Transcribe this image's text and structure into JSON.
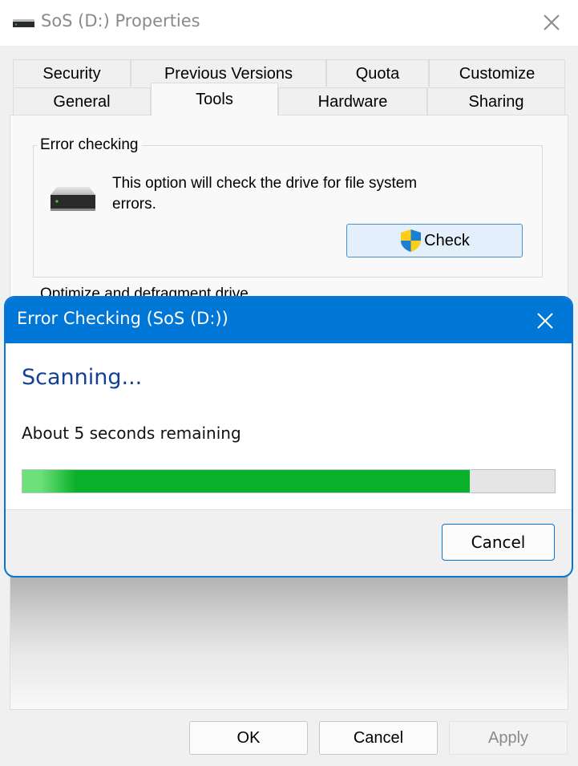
{
  "window": {
    "title": "SoS (D:) Properties",
    "icon": "drive-icon",
    "close_icon": "close-icon"
  },
  "tabs": {
    "row_top": [
      {
        "label": "Security"
      },
      {
        "label": "Previous Versions"
      },
      {
        "label": "Quota"
      },
      {
        "label": "Customize"
      }
    ],
    "row_bottom": [
      {
        "label": "General"
      },
      {
        "label": "Tools",
        "active": true
      },
      {
        "label": "Hardware"
      },
      {
        "label": "Sharing"
      }
    ]
  },
  "tools": {
    "error_checking": {
      "legend": "Error checking",
      "description": "This option will check the drive for file system errors.",
      "check_button": "Check",
      "check_icon": "uac-shield-icon"
    },
    "optimize": {
      "legend": "Optimize and defragment drive"
    }
  },
  "footer": {
    "ok": "OK",
    "cancel": "Cancel",
    "apply": "Apply",
    "apply_enabled": false
  },
  "dialog": {
    "title": "Error Checking (SoS (D:))",
    "heading": "Scanning...",
    "status": "About 5 seconds remaining",
    "progress_fraction": 0.84,
    "cancel": "Cancel",
    "colors": {
      "titlebar": "#0077d6",
      "heading": "#143f96",
      "progress": "#09b029"
    }
  }
}
